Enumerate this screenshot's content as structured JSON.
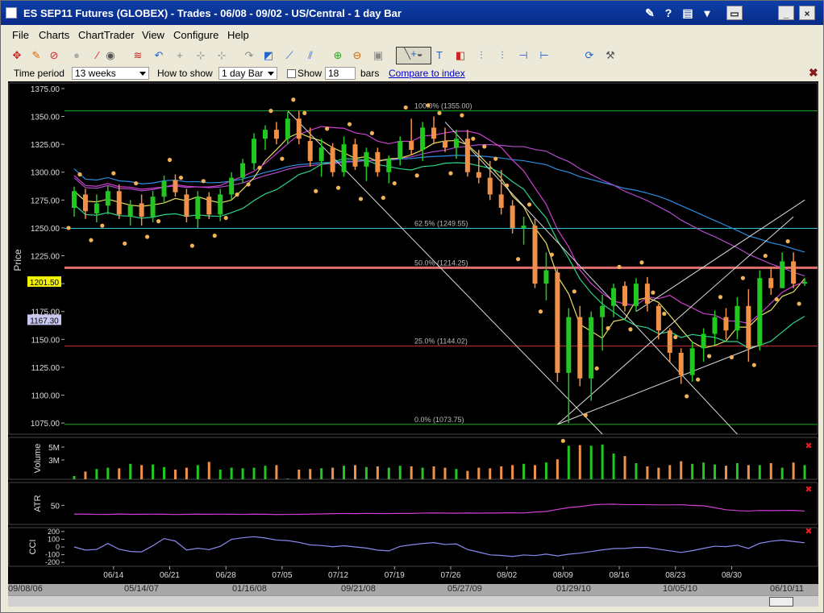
{
  "window": {
    "title": "ES SEP11 Futures (GLOBEX) - Trades - 06/08 - 09/02 - US/Central - 1 day Bar"
  },
  "menu": [
    "File",
    "Charts",
    "ChartTrader",
    "View",
    "Configure",
    "Help"
  ],
  "options": {
    "time_period_label": "Time period",
    "time_period_value": "13 weeks",
    "how_to_show_label": "How to show",
    "how_to_show_value": "1 day Bar",
    "show_label": "Show",
    "show_value": "18",
    "bars_label": "bars",
    "compare_link": "Compare to index"
  },
  "colors": {
    "background": "#000000",
    "up_bar": "#22c722",
    "down_bar": "#f0914a",
    "sar": "#f2b25a",
    "ma_fast": "#e8e060",
    "ma_mid": "#2ed48a",
    "ma_slow": "#2b8ee0",
    "ma_purple": "#b04ac8",
    "bb_upper": "#d040d0",
    "fib_100": "#22aa22",
    "fib_62": "#30c8d0",
    "fib_50": "#e07070",
    "fib_25": "#d03030",
    "fib_0": "#22aa22"
  },
  "chart_data": [
    {
      "type": "candlestick",
      "ylabel": "Price",
      "ylim": [
        1065,
        1380
      ],
      "y_ticks": [
        1375,
        1350,
        1325,
        1300,
        1275,
        1250,
        1225,
        1200,
        1175,
        1150,
        1125,
        1100,
        1075
      ],
      "y_tick_labels": [
        "1375.00",
        "1350.00",
        "1325.00",
        "1300.00",
        "1275.00",
        "1250.00",
        "1225.00",
        "1200.00",
        "1175.00",
        "1150.00",
        "1125.00",
        "1100.00",
        "1075.00"
      ],
      "x_labels": [
        "06/14",
        "06/21",
        "06/28",
        "07/05",
        "07/12",
        "07/19",
        "07/26",
        "08/02",
        "08/09",
        "08/16",
        "08/23",
        "08/30"
      ],
      "x_label_bars": [
        3.5,
        8.5,
        13.5,
        18.5,
        23.5,
        28.5,
        33.5,
        38.5,
        43.5,
        48.5,
        53.5,
        58.5
      ],
      "last_price_label": "1201.50",
      "last_price": 1201.5,
      "secondary_price_label": "1167.30",
      "secondary_price": 1167.3,
      "fib_levels": [
        {
          "label": "100.0% (1355.00)",
          "value": 1355.0
        },
        {
          "label": "62.5% (1249.55)",
          "value": 1249.55
        },
        {
          "label": "50.0% (1214.25)",
          "value": 1214.25
        },
        {
          "label": "25.0% (1144.02)",
          "value": 1144.02
        },
        {
          "label": "0.0% (1073.75)",
          "value": 1073.75
        }
      ],
      "bars": [
        {
          "o": 1268,
          "h": 1287,
          "l": 1260,
          "c": 1283,
          "dir": "up"
        },
        {
          "o": 1280,
          "h": 1285,
          "l": 1258,
          "c": 1265,
          "dir": "down"
        },
        {
          "o": 1263,
          "h": 1280,
          "l": 1255,
          "c": 1272,
          "dir": "up"
        },
        {
          "o": 1270,
          "h": 1288,
          "l": 1262,
          "c": 1283,
          "dir": "up"
        },
        {
          "o": 1283,
          "h": 1289,
          "l": 1258,
          "c": 1262,
          "dir": "down"
        },
        {
          "o": 1260,
          "h": 1275,
          "l": 1252,
          "c": 1270,
          "dir": "up"
        },
        {
          "o": 1272,
          "h": 1280,
          "l": 1252,
          "c": 1260,
          "dir": "down"
        },
        {
          "o": 1260,
          "h": 1283,
          "l": 1255,
          "c": 1278,
          "dir": "up"
        },
        {
          "o": 1278,
          "h": 1297,
          "l": 1272,
          "c": 1292,
          "dir": "up"
        },
        {
          "o": 1293,
          "h": 1298,
          "l": 1278,
          "c": 1282,
          "dir": "down"
        },
        {
          "o": 1280,
          "h": 1285,
          "l": 1255,
          "c": 1260,
          "dir": "down"
        },
        {
          "o": 1258,
          "h": 1283,
          "l": 1250,
          "c": 1278,
          "dir": "up"
        },
        {
          "o": 1278,
          "h": 1282,
          "l": 1258,
          "c": 1262,
          "dir": "down"
        },
        {
          "o": 1262,
          "h": 1285,
          "l": 1256,
          "c": 1280,
          "dir": "up"
        },
        {
          "o": 1280,
          "h": 1300,
          "l": 1275,
          "c": 1295,
          "dir": "up"
        },
        {
          "o": 1295,
          "h": 1312,
          "l": 1290,
          "c": 1308,
          "dir": "up"
        },
        {
          "o": 1308,
          "h": 1335,
          "l": 1302,
          "c": 1330,
          "dir": "up"
        },
        {
          "o": 1330,
          "h": 1342,
          "l": 1320,
          "c": 1338,
          "dir": "up"
        },
        {
          "o": 1338,
          "h": 1345,
          "l": 1325,
          "c": 1330,
          "dir": "down"
        },
        {
          "o": 1330,
          "h": 1354,
          "l": 1325,
          "c": 1348,
          "dir": "up"
        },
        {
          "o": 1348,
          "h": 1355,
          "l": 1325,
          "c": 1330,
          "dir": "down"
        },
        {
          "o": 1328,
          "h": 1340,
          "l": 1305,
          "c": 1310,
          "dir": "down"
        },
        {
          "o": 1310,
          "h": 1330,
          "l": 1296,
          "c": 1322,
          "dir": "up"
        },
        {
          "o": 1322,
          "h": 1326,
          "l": 1296,
          "c": 1300,
          "dir": "down"
        },
        {
          "o": 1300,
          "h": 1332,
          "l": 1296,
          "c": 1325,
          "dir": "up"
        },
        {
          "o": 1325,
          "h": 1330,
          "l": 1302,
          "c": 1305,
          "dir": "down"
        },
        {
          "o": 1305,
          "h": 1322,
          "l": 1292,
          "c": 1318,
          "dir": "up"
        },
        {
          "o": 1318,
          "h": 1322,
          "l": 1296,
          "c": 1300,
          "dir": "down"
        },
        {
          "o": 1300,
          "h": 1315,
          "l": 1290,
          "c": 1312,
          "dir": "up"
        },
        {
          "o": 1312,
          "h": 1332,
          "l": 1306,
          "c": 1328,
          "dir": "up"
        },
        {
          "o": 1328,
          "h": 1348,
          "l": 1315,
          "c": 1320,
          "dir": "down"
        },
        {
          "o": 1320,
          "h": 1345,
          "l": 1310,
          "c": 1340,
          "dir": "up"
        },
        {
          "o": 1340,
          "h": 1350,
          "l": 1325,
          "c": 1330,
          "dir": "down"
        },
        {
          "o": 1328,
          "h": 1340,
          "l": 1318,
          "c": 1322,
          "dir": "down"
        },
        {
          "o": 1322,
          "h": 1338,
          "l": 1312,
          "c": 1330,
          "dir": "up"
        },
        {
          "o": 1330,
          "h": 1338,
          "l": 1296,
          "c": 1300,
          "dir": "down"
        },
        {
          "o": 1300,
          "h": 1320,
          "l": 1290,
          "c": 1295,
          "dir": "down"
        },
        {
          "o": 1295,
          "h": 1310,
          "l": 1275,
          "c": 1280,
          "dir": "down"
        },
        {
          "o": 1280,
          "h": 1302,
          "l": 1262,
          "c": 1268,
          "dir": "down"
        },
        {
          "o": 1270,
          "h": 1275,
          "l": 1245,
          "c": 1250,
          "dir": "down"
        },
        {
          "o": 1250,
          "h": 1260,
          "l": 1235,
          "c": 1252,
          "dir": "up"
        },
        {
          "o": 1252,
          "h": 1258,
          "l": 1196,
          "c": 1200,
          "dir": "down"
        },
        {
          "o": 1200,
          "h": 1228,
          "l": 1185,
          "c": 1212,
          "dir": "up"
        },
        {
          "o": 1210,
          "h": 1213,
          "l": 1112,
          "c": 1120,
          "dir": "down"
        },
        {
          "o": 1120,
          "h": 1178,
          "l": 1075,
          "c": 1170,
          "dir": "up"
        },
        {
          "o": 1170,
          "h": 1180,
          "l": 1108,
          "c": 1115,
          "dir": "down"
        },
        {
          "o": 1115,
          "h": 1175,
          "l": 1095,
          "c": 1170,
          "dir": "up"
        },
        {
          "o": 1170,
          "h": 1190,
          "l": 1140,
          "c": 1180,
          "dir": "up"
        },
        {
          "o": 1180,
          "h": 1200,
          "l": 1170,
          "c": 1196,
          "dir": "up"
        },
        {
          "o": 1198,
          "h": 1202,
          "l": 1175,
          "c": 1180,
          "dir": "down"
        },
        {
          "o": 1180,
          "h": 1205,
          "l": 1175,
          "c": 1200,
          "dir": "up"
        },
        {
          "o": 1200,
          "h": 1206,
          "l": 1175,
          "c": 1182,
          "dir": "down"
        },
        {
          "o": 1180,
          "h": 1182,
          "l": 1150,
          "c": 1158,
          "dir": "down"
        },
        {
          "o": 1158,
          "h": 1160,
          "l": 1130,
          "c": 1138,
          "dir": "down"
        },
        {
          "o": 1138,
          "h": 1142,
          "l": 1110,
          "c": 1118,
          "dir": "down"
        },
        {
          "o": 1118,
          "h": 1148,
          "l": 1112,
          "c": 1142,
          "dir": "up"
        },
        {
          "o": 1142,
          "h": 1160,
          "l": 1130,
          "c": 1155,
          "dir": "up"
        },
        {
          "o": 1155,
          "h": 1176,
          "l": 1145,
          "c": 1170,
          "dir": "up"
        },
        {
          "o": 1170,
          "h": 1178,
          "l": 1150,
          "c": 1158,
          "dir": "down"
        },
        {
          "o": 1158,
          "h": 1188,
          "l": 1150,
          "c": 1180,
          "dir": "up"
        },
        {
          "o": 1180,
          "h": 1195,
          "l": 1130,
          "c": 1142,
          "dir": "down"
        },
        {
          "o": 1145,
          "h": 1212,
          "l": 1140,
          "c": 1205,
          "dir": "up"
        },
        {
          "o": 1205,
          "h": 1215,
          "l": 1190,
          "c": 1196,
          "dir": "down"
        },
        {
          "o": 1196,
          "h": 1228,
          "l": 1196,
          "c": 1220,
          "dir": "up"
        },
        {
          "o": 1220,
          "h": 1228,
          "l": 1196,
          "c": 1200,
          "dir": "down"
        },
        {
          "o": 1200,
          "h": 1205,
          "l": 1198,
          "c": 1201.5,
          "dir": "up"
        }
      ]
    },
    {
      "type": "bar",
      "ylabel": "Volume",
      "y_tick_labels": [
        "5M",
        "3M"
      ],
      "y_ticks": [
        5,
        3
      ],
      "ylim": [
        0,
        6.5
      ],
      "values": [
        0.5,
        1.2,
        1.6,
        1.8,
        1.7,
        2.4,
        2.2,
        2.3,
        1.9,
        1.5,
        1.8,
        2.2,
        2.7,
        1.5,
        1.8,
        1.7,
        1.8,
        2.1,
        2.2,
        0.1,
        1.5,
        1.6,
        1.7,
        1.8,
        2.1,
        2.2,
        1.9,
        2.0,
        1.8,
        2.1,
        2.0,
        1.8,
        2.0,
        1.8,
        1.6,
        1.3,
        1.8,
        1.7,
        2.0,
        2.2,
        2.4,
        2.2,
        2.6,
        3.1,
        5.2,
        5.3,
        5.2,
        5.4,
        4.0,
        3.6,
        2.5,
        2.0,
        1.8,
        2.2,
        2.8,
        2.4,
        2.6,
        2.3,
        2.1,
        2.5,
        2.2,
        2.2,
        2.5,
        1.8,
        2.6,
        2.2
      ]
    },
    {
      "type": "line",
      "ylabel": "ATR",
      "y_tick_labels": [
        "50"
      ],
      "y_ticks": [
        50
      ],
      "ylim": [
        0,
        110
      ]
    },
    {
      "type": "line",
      "ylabel": "CCI",
      "y_tick_labels": [
        "200",
        "100",
        "0",
        "-100",
        "-200"
      ],
      "y_ticks": [
        200,
        100,
        0,
        -100,
        -200
      ],
      "ylim": [
        -250,
        250
      ]
    }
  ],
  "navigator": [
    "09/08/06",
    "05/14/07",
    "01/16/08",
    "09/21/08",
    "05/27/09",
    "01/29/10",
    "10/05/10",
    "06/10/11"
  ]
}
